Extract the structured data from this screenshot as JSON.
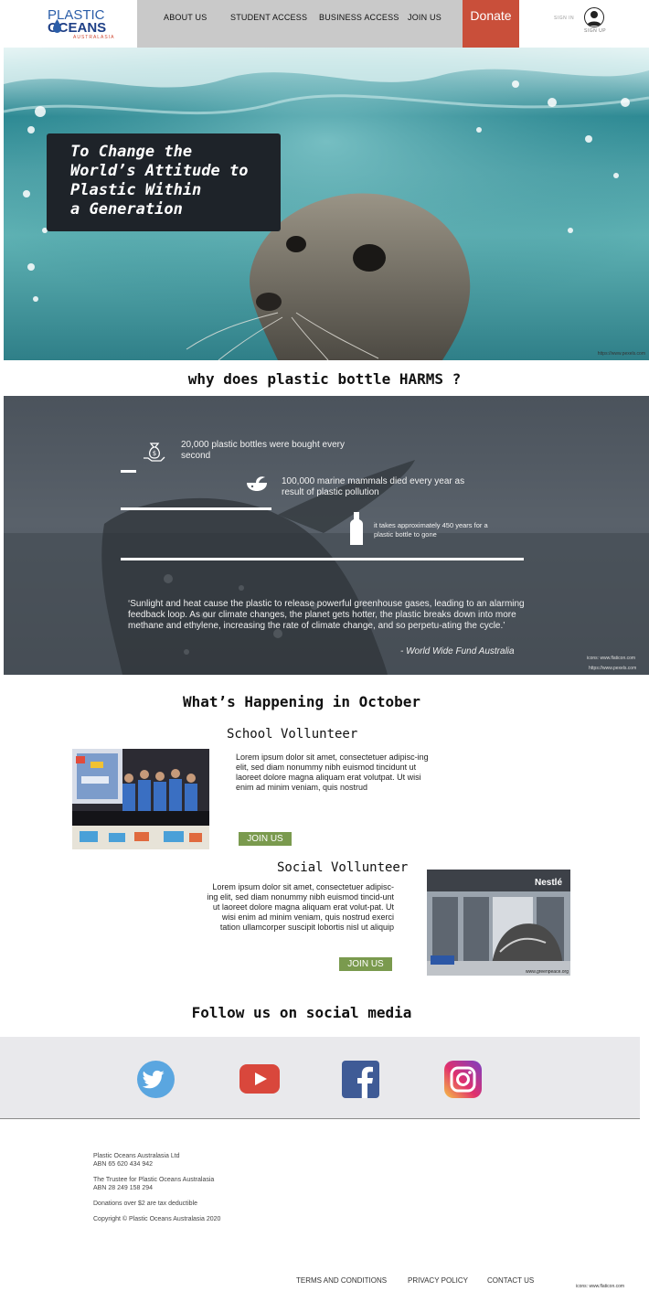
{
  "nav": {
    "logo_line1": "PLASTIC",
    "logo_line2": "OCEANS",
    "logo_line3": "AUSTRALASIA",
    "links": [
      "ABOUT US",
      "STUDENT ACCESS",
      "BUSINESS ACCESS",
      "JOIN US"
    ],
    "donate": "Donate",
    "sign_in": "SIGN IN",
    "sign_up": "SIGN UP"
  },
  "hero": {
    "title": "To Change the\nWorld’s Attitude to\nPlastic Within\na Generation",
    "credit": "https://www.pexels.com"
  },
  "why": {
    "title": "why does plastic bottle HARMS ?",
    "facts": [
      {
        "text": "20,000 plastic bottles were bought every\nsecond",
        "icon": "money-bag-icon"
      },
      {
        "text": "100,000 marine mammals died every year as\nresult of plastic pollution",
        "icon": "whale-icon"
      },
      {
        "text": "it takes approximately 450 years for a\nplastic bottle to gone",
        "icon": "bottle-icon"
      }
    ],
    "quote": "‘Sunlight and heat cause the plastic to release powerful greenhouse gases, leading to an alarming feedback loop. As our climate changes, the planet gets hotter, the plastic breaks down into more methane and ethylene, increasing the rate of climate change, and so perpetu-ating the cycle.’",
    "quote_author": "- World Wide Fund Australia",
    "icons_credit": "icons:   www.flaticon.com",
    "photo_credit": "https://www.pexels.com"
  },
  "events": {
    "title": "What’s Happening in October",
    "items": [
      {
        "title": "School Vollunteer",
        "text": "Lorem ipsum dolor sit amet, consectetuer adipisc-ing elit, sed diam nonummy nibh euismod tincidunt ut laoreet dolore magna aliquam erat volutpat. Ut wisi enim ad minim veniam, quis nostrud",
        "button": "JOIN US"
      },
      {
        "title": "Social Vollunteer",
        "text": "Lorem ipsum dolor sit amet, consectetuer adipisc-ing elit, sed diam nonummy nibh euismod tincid-unt ut laoreet dolore magna aliquam erat volut-pat. Ut wisi enim ad minim veniam, quis nostrud exerci tation ullamcorper suscipit lobortis nisl ut aliquip",
        "button": "JOIN US",
        "photo_sign": "Nestlé",
        "photo_credit": "www.greenpeace.org"
      }
    ]
  },
  "social": {
    "title": "Follow us on social media",
    "icons": [
      "twitter-icon",
      "youtube-icon",
      "facebook-icon",
      "instagram-icon"
    ]
  },
  "footer": {
    "company": "Plastic Oceans Australasia Ltd\nABN 65 620 434 942",
    "trustee": "The Trustee for Plastic Oceans Australasia\nABN 28 249 158 294",
    "donations": "Donations over $2 are tax deductible",
    "copyright": "Copyright © Plastic Oceans Australasia 2020",
    "links": [
      "TERMS AND CONDITIONS",
      "PRIVACY POLICY",
      "CONTACT US"
    ],
    "icons_credit": "icons:   www.flaticon.com"
  },
  "colors": {
    "donate": "#c94f3a",
    "join_button": "#7a9a4e",
    "hero_box": "#1e2329",
    "facts_bg": "#535b64"
  }
}
